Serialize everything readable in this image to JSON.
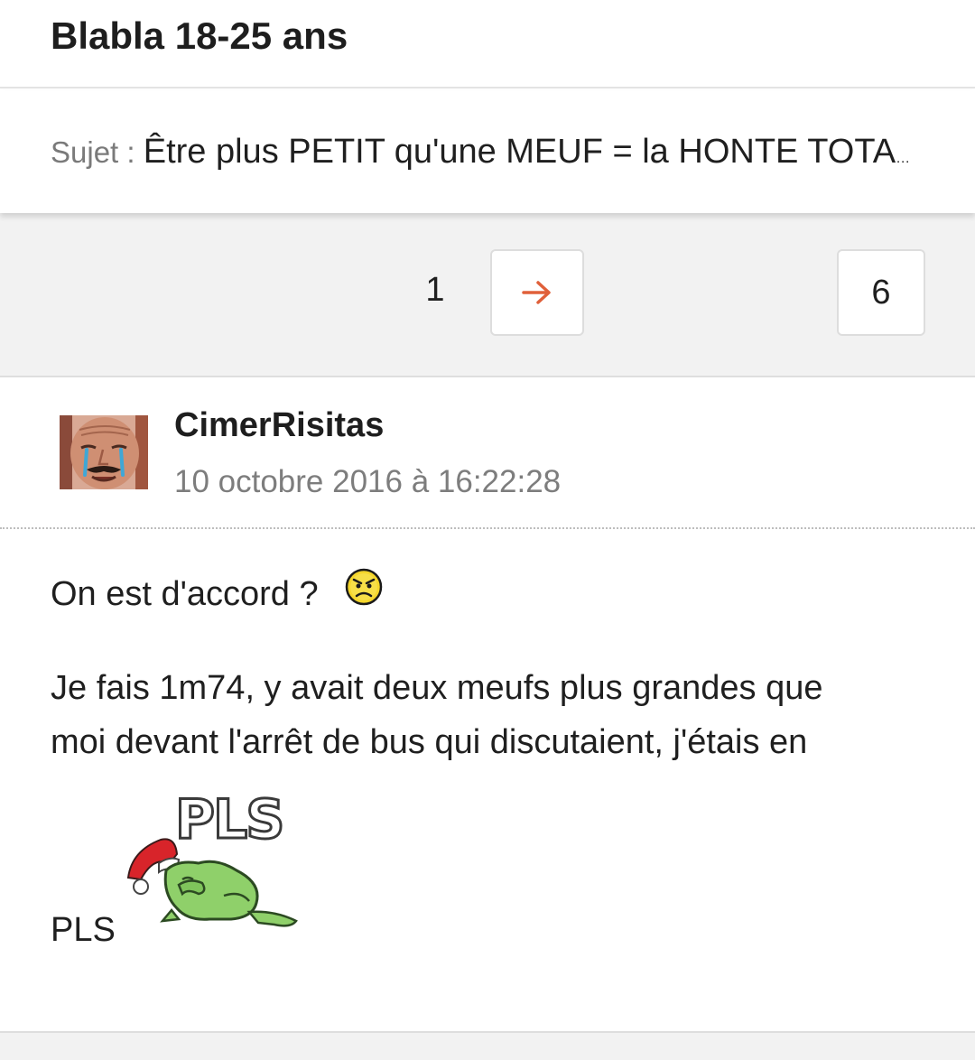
{
  "header": {
    "forum_title": "Blabla 18-25 ans"
  },
  "subject": {
    "prefix": "Sujet : ",
    "title": "Être plus PETIT qu'une MEUF = la HONTE TOTALE"
  },
  "pagination": {
    "current_page": "1",
    "next_icon": "arrow-right-icon",
    "last_page": "6"
  },
  "post": {
    "author": "CimerRisitas",
    "date": "10 octobre 2016 à 16:22:28",
    "avatar_icon": "risitas-crying-avatar",
    "paragraphs": [
      "On est d'accord ? ",
      "Je fais 1m74, y avait deux meufs plus grandes que",
      "moi devant l'arrêt de bus qui discutaient, j'étais en",
      "PLS"
    ],
    "smiley_icon": "angry-smiley-icon",
    "sticker_text": "PLS"
  },
  "colors": {
    "accent": "#e0603a",
    "muted_text": "#7d7d7d",
    "page_bg": "#f2f2f2"
  }
}
